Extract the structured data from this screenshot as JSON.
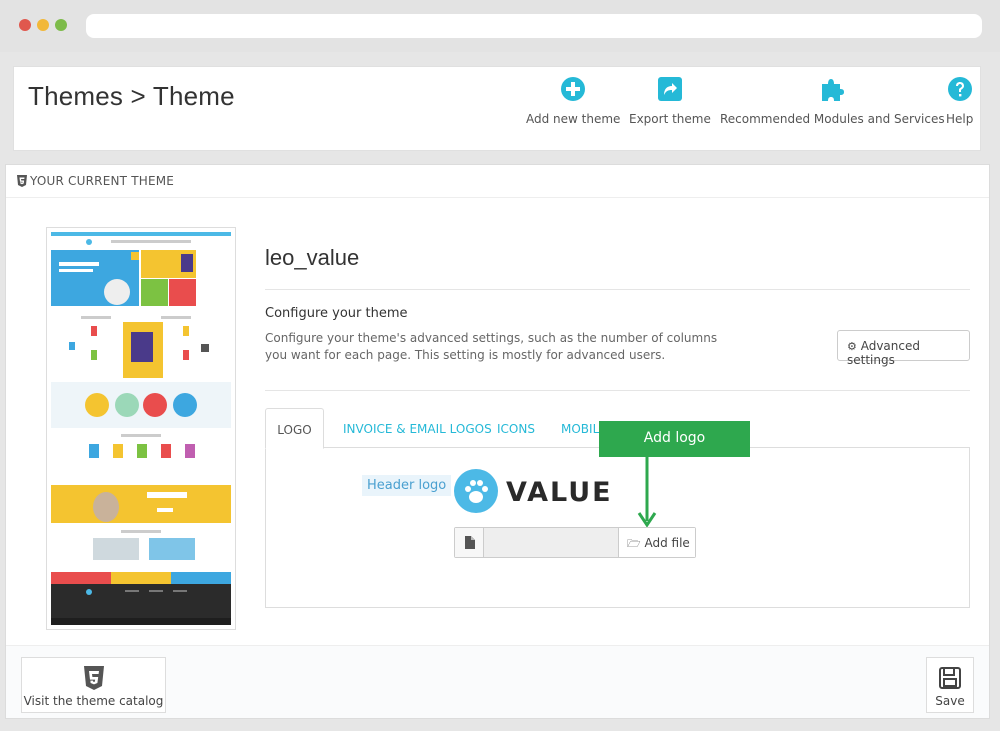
{
  "header": {
    "title": "Themes > Theme",
    "actions": [
      {
        "label": "Add new theme",
        "icon": "plus-circle-icon"
      },
      {
        "label": "Export theme",
        "icon": "share-icon"
      },
      {
        "label": "Recommended Modules and Services",
        "icon": "puzzle-icon"
      },
      {
        "label": "Help",
        "icon": "question-circle-icon"
      }
    ]
  },
  "panel": {
    "heading": "Your current theme",
    "theme_name": "leo_value",
    "configure_title": "Configure your theme",
    "configure_desc": "Configure your theme's advanced settings, such as the number of columns you want for each page. This setting is mostly for advanced users.",
    "advanced_button": "Advanced settings",
    "tabs": [
      {
        "label": "Logo",
        "active": true
      },
      {
        "label": "Invoice & Email logos",
        "active": false
      },
      {
        "label": "Icons",
        "active": false
      },
      {
        "label": "Mobile",
        "active": false
      }
    ],
    "header_logo_label": "Header logo",
    "logo_text": "VALUE",
    "file_input_value": "",
    "add_file_button": "Add file",
    "callout": "Add logo"
  },
  "footer": {
    "catalog_button": "Visit the theme catalog",
    "save_button": "Save"
  },
  "colors": {
    "accent": "#25b9d7",
    "callout": "#2ea84e",
    "logo_blue": "#4cb9e6"
  }
}
